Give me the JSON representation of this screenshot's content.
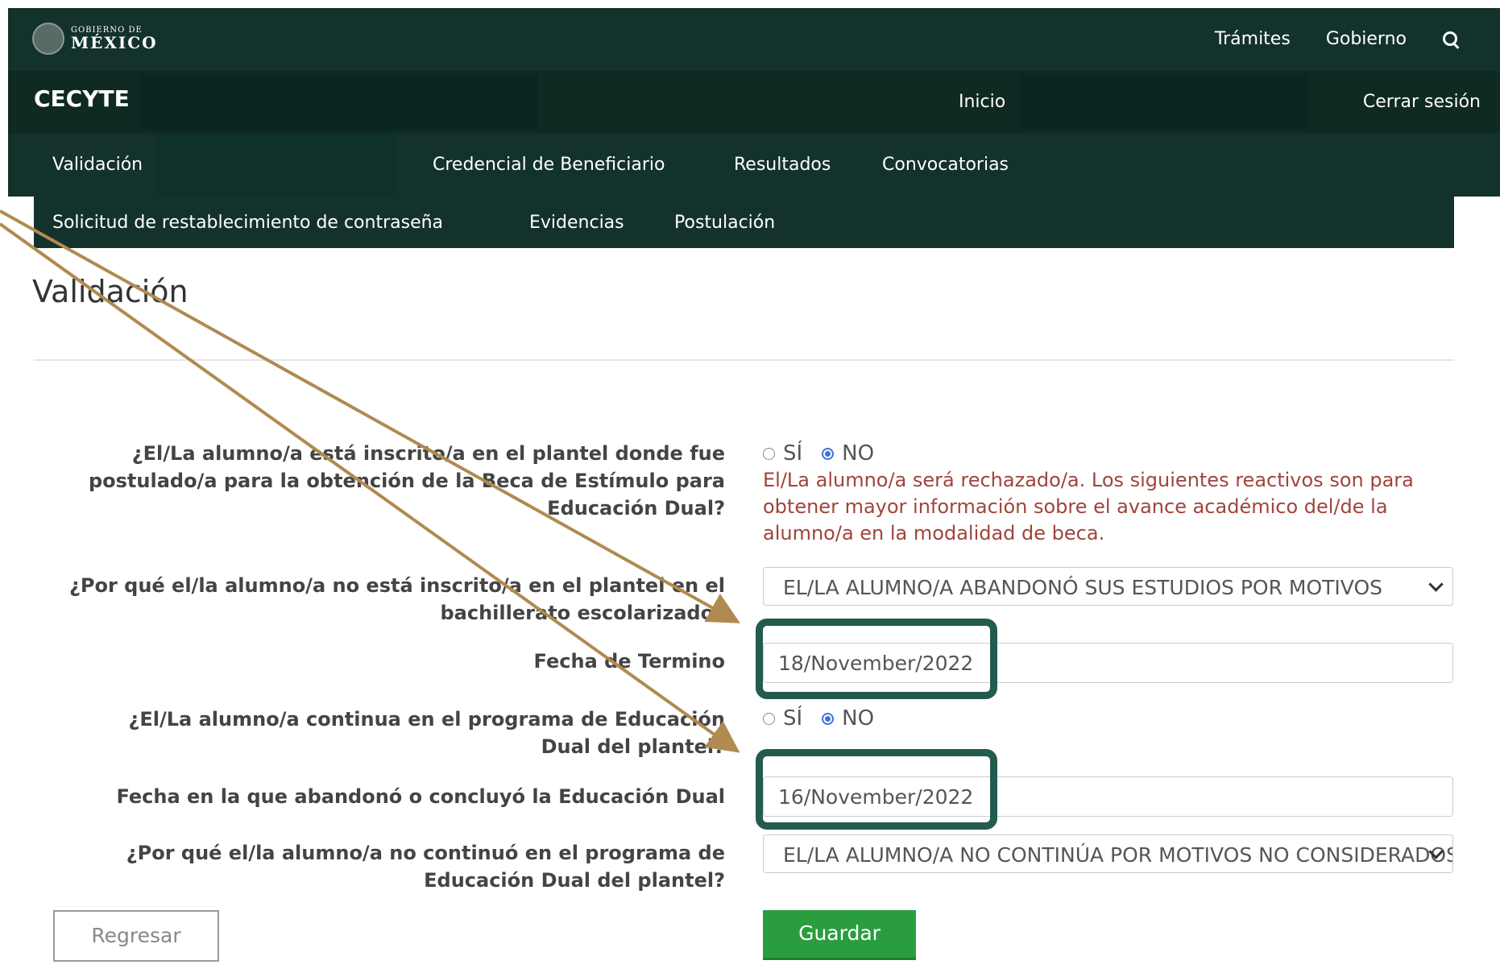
{
  "header": {
    "logo_small": "GOBIERNO DE",
    "logo_big": "MÉXICO",
    "nav": [
      "Trámites",
      "Gobierno"
    ],
    "search_icon": "search-icon"
  },
  "subheader": {
    "brand": "CECYTE",
    "home": "Inicio",
    "logout": "Cerrar sesión"
  },
  "menu": {
    "row1": [
      "Validación",
      "Credencial de Beneficiario",
      "Resultados",
      "Convocatorias"
    ],
    "row2": [
      "Solicitud de restablecimiento de contraseña",
      "Evidencias",
      "Postulación"
    ]
  },
  "page": {
    "title": "Validación"
  },
  "form": {
    "q1": {
      "label_line1": "¿El/La alumno/a está inscrito/a en el plantel donde fue",
      "label_line2": "postulado/a para la obtención de la Beca de Estímulo para",
      "label_line3": "Educación Dual?",
      "opt_yes": "SÍ",
      "opt_no": "NO",
      "selected": "NO",
      "warning": "El/La alumno/a será rechazado/a. Los siguientes reactivos son para obtener mayor información sobre el avance académico del/de la alumno/a en la modalidad de beca."
    },
    "q2": {
      "label_line1": "¿Por qué el/la alumno/a no está inscrito/a en el plantel en el",
      "label_line2": "bachillerato escolarizado?",
      "value": "EL/LA ALUMNO/A ABANDONÓ SUS ESTUDIOS POR MOTIVOS"
    },
    "q3": {
      "label": "Fecha de Termino",
      "value": "18/November/2022"
    },
    "q4": {
      "label_line1": "¿El/La alumno/a continua en el programa de Educación",
      "label_line2": "Dual del plantel?",
      "opt_yes": "SÍ",
      "opt_no": "NO",
      "selected": "NO"
    },
    "q5": {
      "label": "Fecha en la que abandonó o concluyó la Educación Dual",
      "value": "16/November/2022"
    },
    "q6": {
      "label_line1": "¿Por qué el/la alumno/a no continuó en el programa de",
      "label_line2": "Educación Dual del plantel?",
      "value": "EL/LA ALUMNO/A NO CONTINÚA POR MOTIVOS NO CONSIDERADOS"
    },
    "back_label": "Regresar",
    "save_label": "Guardar"
  },
  "colors": {
    "header_bg": "#13322b",
    "highlight": "#235b4e",
    "arrow": "#b08a50",
    "save": "#2a9d3f",
    "warning": "#a0443c"
  }
}
